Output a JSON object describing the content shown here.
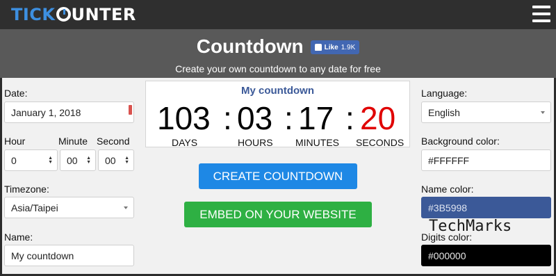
{
  "header": {
    "logo_tick": "TICK",
    "logo_c": "C",
    "logo_unter": "UNTER",
    "menu_icon": "hamburger-menu-icon"
  },
  "banner": {
    "title": "Countdown",
    "like_label": "Like",
    "like_count": "1.9K",
    "subtitle": "Create your own countdown to any date for free"
  },
  "form": {
    "date_label": "Date:",
    "date_value": "January 1, 2018",
    "hour_label": "Hour",
    "minute_label": "Minute",
    "second_label": "Second",
    "hour_value": "0",
    "minute_value": "00",
    "second_value": "00",
    "timezone_label": "Timezone:",
    "timezone_value": "Asia/Taipei",
    "name_label": "Name:",
    "name_value": "My countdown"
  },
  "counter": {
    "name": "My countdown",
    "days": "103",
    "hours": "03",
    "minutes": "17",
    "seconds": "20",
    "separator": ":",
    "days_label": "DAYS",
    "hours_label": "HOURS",
    "minutes_label": "MINUTES",
    "seconds_label": "SECONDS"
  },
  "buttons": {
    "create": "CREATE COUNTDOWN",
    "embed": "EMBED ON YOUR WEBSITE"
  },
  "settings": {
    "language_label": "Language:",
    "language_value": "English",
    "bg_label": "Background color:",
    "bg_value": "#FFFFFF",
    "name_color_label": "Name color:",
    "name_color_value": "#3B5998",
    "digits_color_label": "Digits color:",
    "digits_color_value": "#000000"
  },
  "watermark": "TechMarks",
  "colors": {
    "seconds_digit": "#e00000",
    "counter_name": "#3b5998",
    "create_button": "#1e88e5",
    "embed_button": "#2eb043"
  }
}
